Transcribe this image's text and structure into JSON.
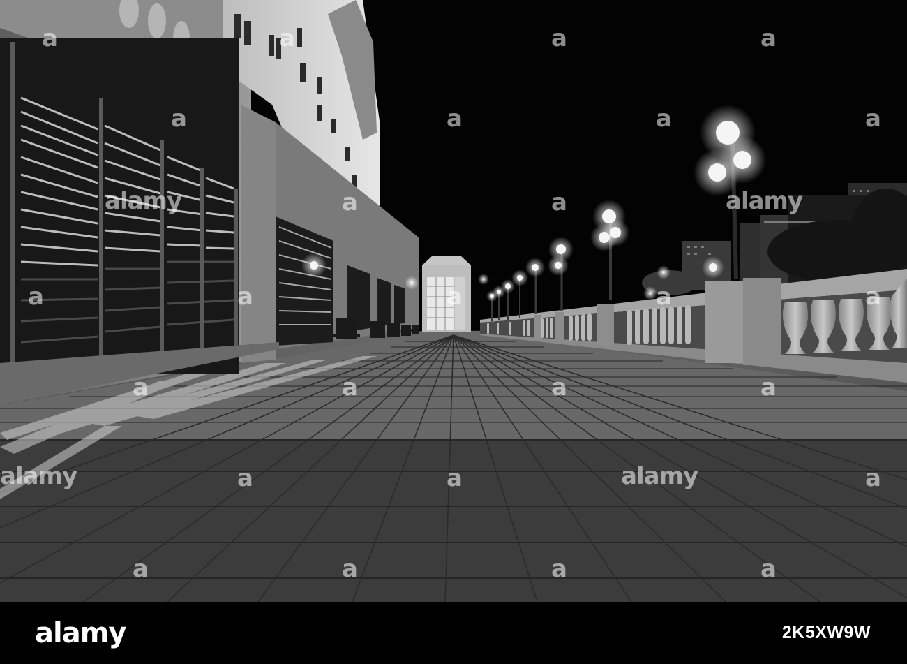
{
  "brand": {
    "logo": "alamy"
  },
  "image": {
    "id": "2K5XW9W"
  },
  "watermark": {
    "text": "alamy",
    "mark": "a"
  }
}
